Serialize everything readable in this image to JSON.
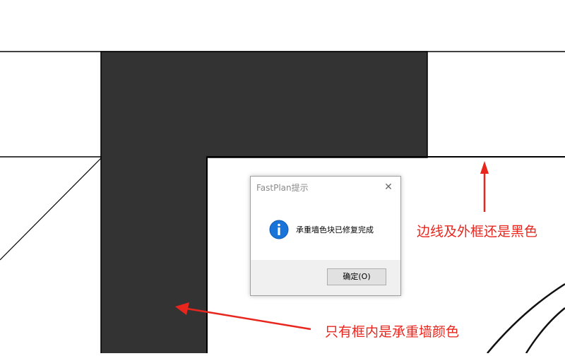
{
  "dialog": {
    "title": "FastPlan提示",
    "close_glyph": "✕",
    "message": "承重墙色块已修复完成",
    "ok_label": "确定(O)",
    "icon": "info-icon"
  },
  "annotations": {
    "border_note": "边线及外框还是黑色",
    "fill_note": "只有框内是承重墙颜色"
  },
  "colors": {
    "wall_fill": "#333333",
    "line": "#000000",
    "annotation_red": "#e8261e",
    "info_blue": "#1a73d8"
  }
}
